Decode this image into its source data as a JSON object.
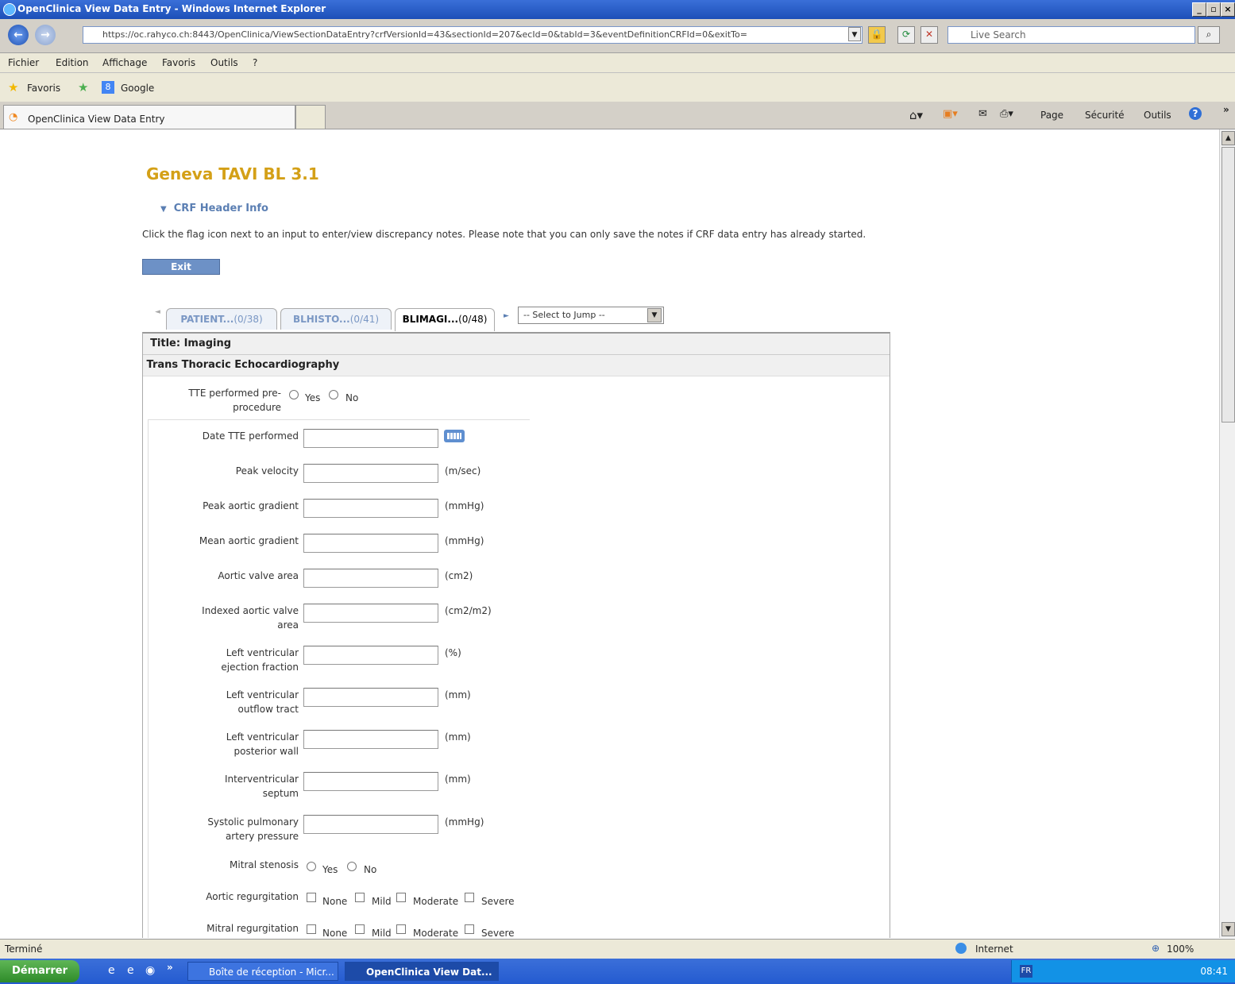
{
  "window": {
    "title": "OpenClinica View Data Entry - Windows Internet Explorer"
  },
  "browser": {
    "url": "https://oc.rahyco.ch:8443/OpenClinica/ViewSectionDataEntry?crfVersionId=43&sectionId=207&ecId=0&tabId=3&eventDefinitionCRFId=0&exitTo=",
    "search_placeholder": "Live Search",
    "menu": [
      "Fichier",
      "Edition",
      "Affichage",
      "Favoris",
      "Outils",
      "?"
    ],
    "favorites_label": "Favoris",
    "favorites_items": [
      "Google"
    ],
    "tab_title": "OpenClinica View Data Entry",
    "commands": [
      "Page",
      "Sécurité",
      "Outils"
    ],
    "status_text": "Terminé",
    "zone": "Internet",
    "zoom": "100%"
  },
  "page": {
    "crf_title": "Geneva TAVI BL 3.1",
    "header_info": "CRF Header Info",
    "note": "Click the flag icon next to an input to enter/view discrepancy notes. Please note that you can only save the notes if CRF data entry has already started.",
    "exit_label": "Exit",
    "tabs": [
      {
        "label": "PATIENT...",
        "count": "(0/38)"
      },
      {
        "label": "BLHISTO...",
        "count": "(0/41)"
      },
      {
        "label": "BLIMAGI...",
        "count": "(0/48)"
      }
    ],
    "jump_select": "-- Select to Jump --",
    "title_row": "Title: Imaging",
    "section": "Trans Thoracic Echocardiography",
    "tte_question": "TTE performed pre- procedure",
    "yes": "Yes",
    "no": "No",
    "fields": [
      {
        "label": "Date TTE performed",
        "unit": ""
      },
      {
        "label": "Peak velocity",
        "unit": "(m/sec)"
      },
      {
        "label": "Peak aortic gradient",
        "unit": "(mmHg)"
      },
      {
        "label": "Mean aortic gradient",
        "unit": "(mmHg)"
      },
      {
        "label": "Aortic valve area",
        "unit": "(cm2)"
      },
      {
        "label": "Indexed aortic valve area",
        "unit": "(cm2/m2)"
      },
      {
        "label": "Left ventricular ejection fraction",
        "unit": "(%)"
      },
      {
        "label": "Left ventricular outflow tract",
        "unit": "(mm)"
      },
      {
        "label": "Left ventricular posterior wall",
        "unit": "(mm)"
      },
      {
        "label": "Interventricular septum",
        "unit": "(mm)"
      },
      {
        "label": "Systolic pulmonary artery pressure",
        "unit": "(mmHg)"
      }
    ],
    "mitral_stenosis": "Mitral stenosis",
    "aortic_regurgitation": "Aortic regurgitation",
    "mitral_regurgitation": "Mitral regurgitation",
    "severity_options": [
      "None",
      "Mild",
      "Moderate",
      "Severe"
    ]
  },
  "taskbar": {
    "start": "Démarrer",
    "tasks": [
      "Boîte de réception - Micr...",
      "OpenClinica View Dat..."
    ],
    "lang": "FR",
    "clock": "08:41"
  }
}
